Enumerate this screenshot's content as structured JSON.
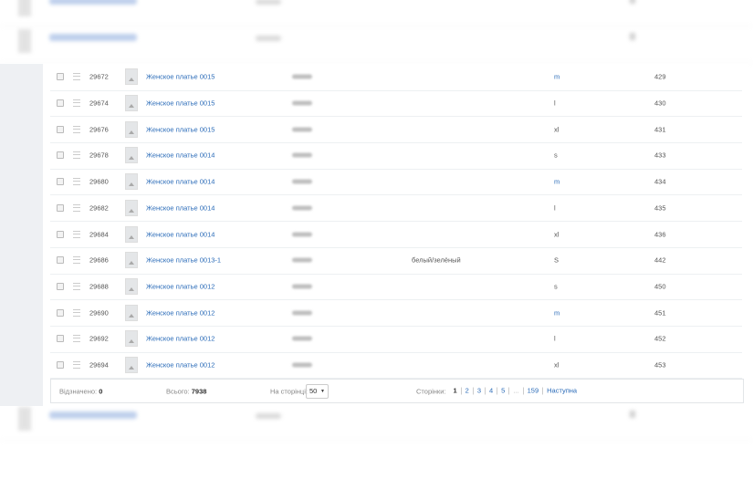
{
  "rows": [
    {
      "id": "29672",
      "name": "Женское платье 0015",
      "color": "",
      "size": "m",
      "qty": "429",
      "size_link": true
    },
    {
      "id": "29674",
      "name": "Женское платье 0015",
      "color": "",
      "size": "l",
      "qty": "430",
      "size_link": false
    },
    {
      "id": "29676",
      "name": "Женское платье 0015",
      "color": "",
      "size": "xl",
      "qty": "431",
      "size_link": false
    },
    {
      "id": "29678",
      "name": "Женское платье 0014",
      "color": "",
      "size": "s",
      "qty": "433",
      "size_link": false
    },
    {
      "id": "29680",
      "name": "Женское платье 0014",
      "color": "",
      "size": "m",
      "qty": "434",
      "size_link": true
    },
    {
      "id": "29682",
      "name": "Женское платье 0014",
      "color": "",
      "size": "l",
      "qty": "435",
      "size_link": false
    },
    {
      "id": "29684",
      "name": "Женское платье 0014",
      "color": "",
      "size": "xl",
      "qty": "436",
      "size_link": false
    },
    {
      "id": "29686",
      "name": "Женское платье 0013-1",
      "color": "белый/зелёный",
      "size": "S",
      "qty": "442",
      "size_link": false
    },
    {
      "id": "29688",
      "name": "Женское платье 0012",
      "color": "",
      "size": "s",
      "qty": "450",
      "size_link": false
    },
    {
      "id": "29690",
      "name": "Женское платье 0012",
      "color": "",
      "size": "m",
      "qty": "451",
      "size_link": true
    },
    {
      "id": "29692",
      "name": "Женское платье 0012",
      "color": "",
      "size": "l",
      "qty": "452",
      "size_link": false
    },
    {
      "id": "29694",
      "name": "Женское платье 0012",
      "color": "",
      "size": "xl",
      "qty": "453",
      "size_link": false
    }
  ],
  "footer": {
    "selected_label": "Відзначено:",
    "selected_value": "0",
    "total_label": "Всього:",
    "total_value": "7938",
    "per_page_label": "На сторінці:",
    "per_page_value": "50",
    "pages_label": "Сторінки:",
    "pages": [
      "1",
      "2",
      "3",
      "4",
      "5",
      "...",
      "159"
    ],
    "current_page": "1",
    "next_label": "Наступна"
  }
}
